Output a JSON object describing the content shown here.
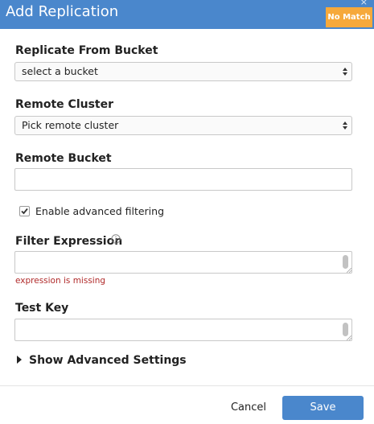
{
  "dialog": {
    "title": "Add Replication",
    "close_glyph": "×",
    "status_badge": "No Match"
  },
  "form": {
    "from_bucket": {
      "label": "Replicate From Bucket",
      "value": "select a bucket"
    },
    "remote_cluster": {
      "label": "Remote Cluster",
      "value": "Pick remote cluster"
    },
    "remote_bucket": {
      "label": "Remote Bucket",
      "value": ""
    },
    "advanced_filtering": {
      "label": "Enable advanced filtering",
      "checked": true
    },
    "filter_expression": {
      "label": "Filter Expression",
      "value": "",
      "error": "expression is missing"
    },
    "test_key": {
      "label": "Test Key",
      "value": ""
    },
    "advanced_settings": {
      "label": "Show Advanced Settings"
    }
  },
  "footer": {
    "cancel_label": "Cancel",
    "save_label": "Save"
  },
  "colors": {
    "header": "#4a87cc",
    "badge": "#f6a93b",
    "error": "#b02a2a",
    "save_button": "#4a87cc"
  },
  "icons": {
    "select_arrows": "up-down-chevron-icon",
    "checkbox": "checkmark-icon",
    "info": "info-circle-icon",
    "expander": "caret-right-icon"
  }
}
